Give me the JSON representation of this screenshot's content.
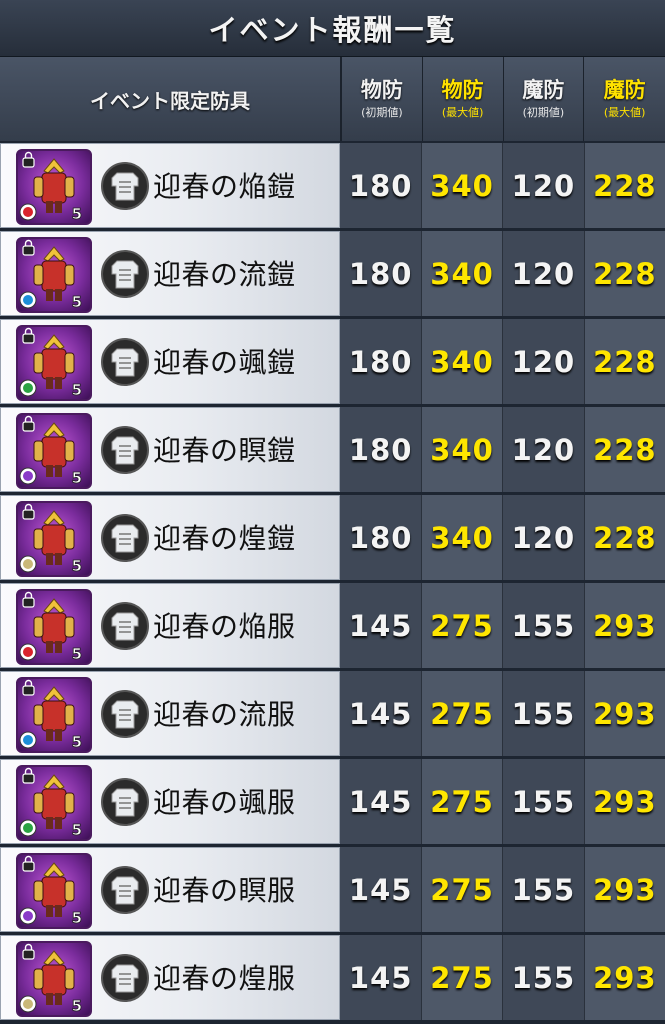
{
  "title": "イベント報酬一覧",
  "header": {
    "name_label": "イベント限定防具",
    "columns": [
      {
        "main": "物防",
        "sub": "(初期値)",
        "kind": "base"
      },
      {
        "main": "物防",
        "sub": "(最大値)",
        "kind": "max"
      },
      {
        "main": "魔防",
        "sub": "(初期値)",
        "kind": "base"
      },
      {
        "main": "魔防",
        "sub": "(最大値)",
        "kind": "max"
      }
    ]
  },
  "colors": {
    "max_value": "#ffe600",
    "header_bg": "#3f4857",
    "name_bg": "#eef0f4"
  },
  "items": [
    {
      "name": "迎春の焔鎧",
      "rarity": "5",
      "element_icon": "fire-icon",
      "element_color": "#d9232b",
      "pdef_base": "180",
      "pdef_max": "340",
      "mdef_base": "120",
      "mdef_max": "228"
    },
    {
      "name": "迎春の流鎧",
      "rarity": "5",
      "element_icon": "water-icon",
      "element_color": "#1c8fd8",
      "pdef_base": "180",
      "pdef_max": "340",
      "mdef_base": "120",
      "mdef_max": "228"
    },
    {
      "name": "迎春の颯鎧",
      "rarity": "5",
      "element_icon": "wind-icon",
      "element_color": "#2aa342",
      "pdef_base": "180",
      "pdef_max": "340",
      "mdef_base": "120",
      "mdef_max": "228"
    },
    {
      "name": "迎春の瞑鎧",
      "rarity": "5",
      "element_icon": "dark-icon",
      "element_color": "#8a3ac8",
      "pdef_base": "180",
      "pdef_max": "340",
      "mdef_base": "120",
      "mdef_max": "228"
    },
    {
      "name": "迎春の煌鎧",
      "rarity": "5",
      "element_icon": "light-icon",
      "element_color": "#c9b878",
      "pdef_base": "180",
      "pdef_max": "340",
      "mdef_base": "120",
      "mdef_max": "228"
    },
    {
      "name": "迎春の焔服",
      "rarity": "5",
      "element_icon": "fire-icon",
      "element_color": "#d9232b",
      "pdef_base": "145",
      "pdef_max": "275",
      "mdef_base": "155",
      "mdef_max": "293"
    },
    {
      "name": "迎春の流服",
      "rarity": "5",
      "element_icon": "water-icon",
      "element_color": "#1c8fd8",
      "pdef_base": "145",
      "pdef_max": "275",
      "mdef_base": "155",
      "mdef_max": "293"
    },
    {
      "name": "迎春の颯服",
      "rarity": "5",
      "element_icon": "wind-icon",
      "element_color": "#2aa342",
      "pdef_base": "145",
      "pdef_max": "275",
      "mdef_base": "155",
      "mdef_max": "293"
    },
    {
      "name": "迎春の瞑服",
      "rarity": "5",
      "element_icon": "dark-icon",
      "element_color": "#8a3ac8",
      "pdef_base": "145",
      "pdef_max": "275",
      "mdef_base": "155",
      "mdef_max": "293"
    },
    {
      "name": "迎春の煌服",
      "rarity": "5",
      "element_icon": "light-icon",
      "element_color": "#c9b878",
      "pdef_base": "145",
      "pdef_max": "275",
      "mdef_base": "155",
      "mdef_max": "293"
    }
  ]
}
